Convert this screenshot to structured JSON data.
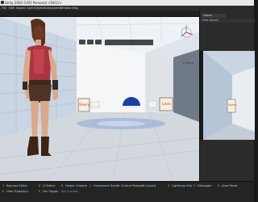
{
  "window": {
    "title": "Unity 2020.3.0f1 Personal <DX11>"
  },
  "menu": {
    "items": [
      "File",
      "Edit",
      "Assets",
      "GameObject",
      "Component",
      "Window",
      "Help"
    ]
  },
  "scene": {
    "persp_label": "< Persp",
    "signs": {
      "left": "Sherry",
      "right": "Leon"
    }
  },
  "game": {
    "tab_label": "Game",
    "aspect": "Free Aspect",
    "sign": "Sherry"
  },
  "console": {
    "counts": [
      "1",
      "0",
      "6",
      "1",
      "0",
      "0",
      "0",
      "0",
      "0",
      "0",
      "0"
    ],
    "entries": [
      "Resume Editor",
      "UI Editor",
      "Helper Camera",
      "Framework Scene",
      "Control Remover",
      "Layout",
      "Lightmap Info",
      "Debugger",
      "Area Reset",
      "Hide Trajectory",
      "Set Trigger",
      "Set Current"
    ]
  },
  "colors": {
    "editor_bg": "#191919",
    "sky": "#dfe6ee",
    "floor": "#d9dde2",
    "sphere": "#1e3fa0",
    "character_vest": "#b03040",
    "sign_text": "#c23b1e"
  }
}
